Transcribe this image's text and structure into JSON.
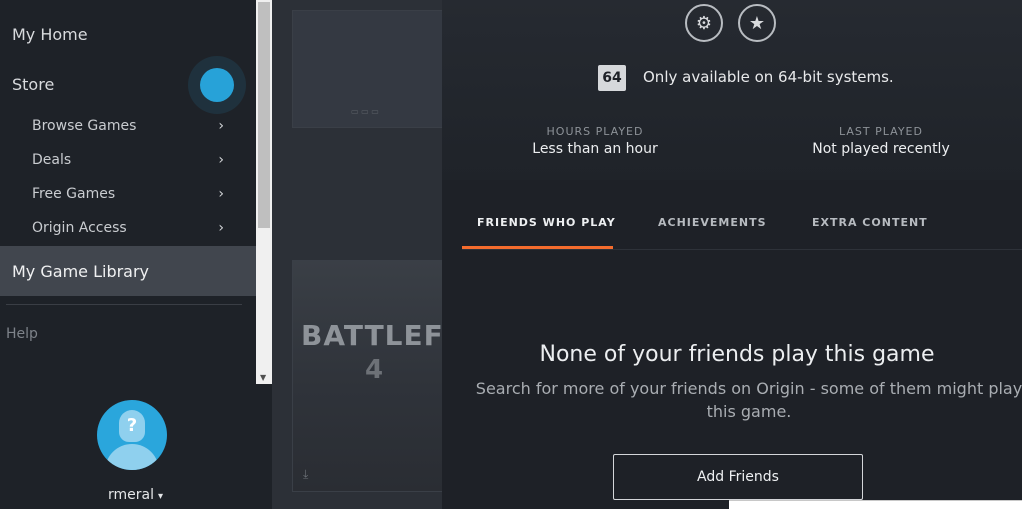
{
  "sidebar": {
    "my_home": "My Home",
    "store": "Store",
    "store_items": [
      {
        "label": "Browse Games"
      },
      {
        "label": "Deals"
      },
      {
        "label": "Free Games"
      },
      {
        "label": "Origin Access"
      }
    ],
    "my_game_library": "My Game Library",
    "help": "Help",
    "username": "rmeral",
    "avatar_glyph": "?"
  },
  "library": {
    "tile2_title": "BATTLEFIELD",
    "tile2_number": "4"
  },
  "details": {
    "badge": "64",
    "system_note": "Only available on 64-bit systems.",
    "hours_played_label": "HOURS PLAYED",
    "hours_played_value": "Less than an hour",
    "last_played_label": "LAST PLAYED",
    "last_played_value": "Not played recently",
    "tabs": [
      {
        "label": "FRIENDS WHO PLAY"
      },
      {
        "label": "ACHIEVEMENTS"
      },
      {
        "label": "EXTRA CONTENT"
      }
    ],
    "empty_title": "None of your friends play this game",
    "empty_subtitle": "Search for more of your friends on Origin - some of them might play this game.",
    "add_friends": "Add Friends"
  },
  "colors": {
    "accent": "#f56c2d",
    "brand_blue": "#27a2d8",
    "sidebar_bg": "#1e2228",
    "selected_bg": "#41464e"
  },
  "icons": {
    "settings": "gear-icon",
    "favorite": "star-icon",
    "chevron": "chevron-right-icon",
    "user": "avatar-icon"
  }
}
